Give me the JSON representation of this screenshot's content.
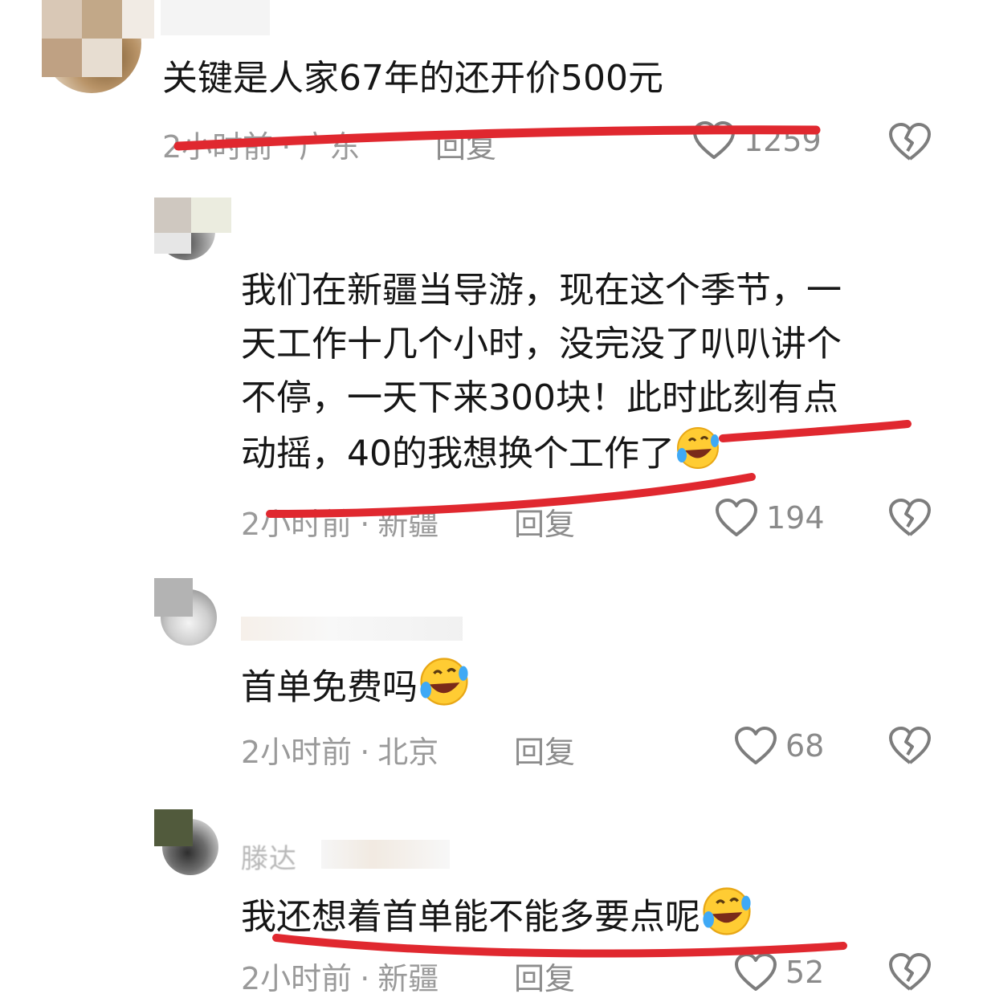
{
  "comments": [
    {
      "text": "关键是人家67年的还开价500元",
      "time": "2小时前",
      "location": "广东",
      "reply": "回复",
      "likes": "1259"
    },
    {
      "name": "",
      "lines": [
        "我们在新疆当导游，现在这个季节，一",
        "天工作十几个小时，没完没了叭叭讲个",
        "不停，一天下来300块！此时此刻有点",
        "动摇，40的我想换个工作了"
      ],
      "time": "2小时前",
      "location": "新疆",
      "reply": "回复",
      "likes": "194",
      "emoji": "rolling-on-floor-laughing-emoji"
    },
    {
      "name": "",
      "text": "首单免费吗",
      "time": "2小时前",
      "location": "北京",
      "reply": "回复",
      "likes": "68",
      "emoji": "rolling-on-floor-laughing-emoji"
    },
    {
      "name": "滕达",
      "text": "我还想着首单能不能多要点呢",
      "time": "2小时前",
      "location": "新疆",
      "reply": "回复",
      "likes": "52",
      "emoji": "rolling-on-floor-laughing-emoji"
    }
  ],
  "colors": {
    "annotation_red": "#e0282f",
    "meta_gray": "#9a9a9a",
    "text_dark": "#161616"
  },
  "icons": {
    "like": "heart-outline-icon",
    "dislike": "broken-heart-icon"
  }
}
